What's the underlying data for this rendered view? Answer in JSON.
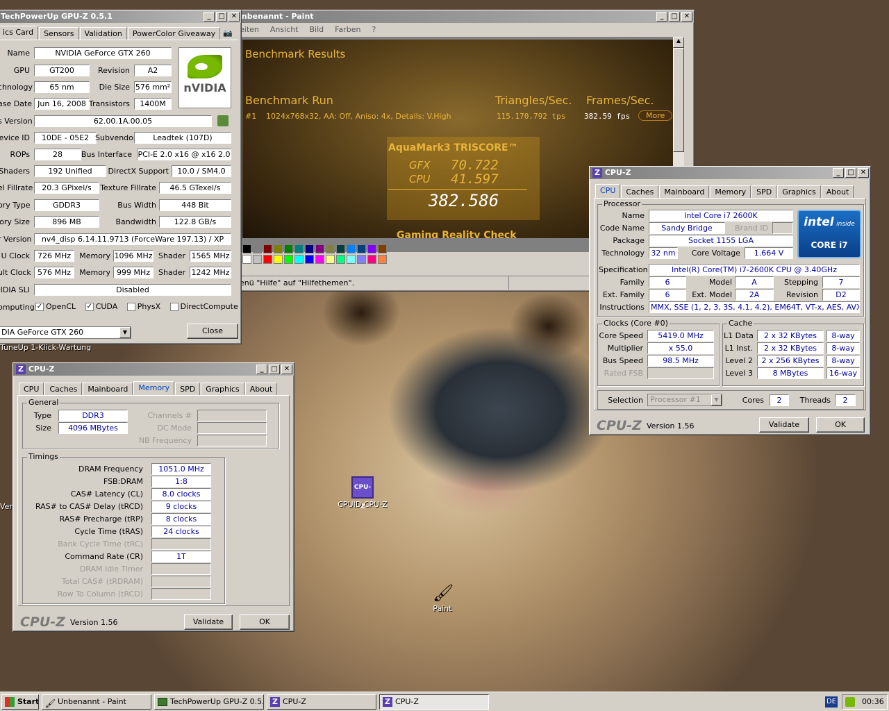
{
  "desktop": {
    "tuneup_label": "TuneUp 1-Klick-Wartung",
    "left_edge_label": "Verk",
    "cpuz_icon_label": "CPUID CPU-Z",
    "paint_icon_label": "Paint"
  },
  "paint": {
    "title": "Unbenannt - Paint",
    "menu": [
      "eiten",
      "Ansicht",
      "Bild",
      "Farben",
      "?"
    ],
    "status": "enü \"Hilfe\" auf \"Hilfethemen\".",
    "palette": [
      "#000000",
      "#808080",
      "#800000",
      "#808000",
      "#008000",
      "#008080",
      "#000080",
      "#800080",
      "#808040",
      "#004040",
      "#0080ff",
      "#004080",
      "#8000ff",
      "#804000",
      "#ffffff",
      "#c0c0c0",
      "#ff0000",
      "#ffff00",
      "#00ff00",
      "#00ffff",
      "#0000ff",
      "#ff00ff",
      "#ffff80",
      "#00ff80",
      "#80ffff",
      "#8080ff",
      "#ff0080",
      "#ff8040"
    ]
  },
  "bench": {
    "header": "Benchmark Results",
    "run": "Benchmark Run",
    "tri": "Triangles/Sec.",
    "fps": "Frames/Sec.",
    "row_num": "#1",
    "row_desc": "1024x768x32, AA: Off, Aniso: 4x, Details: V.High",
    "row_tri": "115.170.792 tps",
    "row_fps": "382.59 fps",
    "more": "More",
    "triscore_title": "AquaMark3 TRISCORE™",
    "gfx_label": "GFX",
    "gfx_value": "70.722",
    "cpu_label": "CPU",
    "cpu_value": "41.597",
    "total": "382.586",
    "gaming": "Gaming Reality Check"
  },
  "gpuz": {
    "title": "TechPowerUp GPU-Z 0.5.1",
    "tabs": [
      "ics Card",
      "Sensors",
      "Validation",
      "PowerColor Giveaway"
    ],
    "name_label": "Name",
    "name": "NVIDIA GeForce GTX 260",
    "gpu_label": "GPU",
    "gpu": "GT200",
    "revision_label": "Revision",
    "revision": "A2",
    "tech_label": "chnology",
    "tech": "65 nm",
    "die_label": "Die Size",
    "die": "576 mm²",
    "release_label": "ase Date",
    "release": "Jun 16, 2008",
    "transistors_label": "Transistors",
    "transistors": "1400M",
    "bios_label": "s Version",
    "bios": "62.00.1A.00.05",
    "devid_label": "evice ID",
    "devid": "10DE - 05E2",
    "subvendor_label": "Subvendor",
    "subvendor": "Leadtek (107D)",
    "rops_label": "ROPs",
    "rops": "28",
    "bus_label": "Bus Interface",
    "bus": "PCI-E 2.0 x16 @ x16 2.0",
    "shaders_label": "Shaders",
    "shaders": "192 Unified",
    "dx_label": "DirectX Support",
    "dx": "10.0 / SM4.0",
    "pfill_label": "el Fillrate",
    "pfill": "20.3 GPixel/s",
    "tfill_label": "Texture Fillrate",
    "tfill": "46.5 GTexel/s",
    "mtype_label": "ory Type",
    "mtype": "GDDR3",
    "bw_label": "Bus Width",
    "bw": "448 Bit",
    "msize_label": "ory Size",
    "msize": "896 MB",
    "bandwidth_label": "Bandwidth",
    "bandwidth": "122.8 GB/s",
    "driver_label": "r Version",
    "driver": "nv4_disp 6.14.11.9713 (ForceWare 197.13) / XP",
    "gclock_label": "U Clock",
    "gclock": "726 MHz",
    "mem_label": "Memory",
    "gmem": "1096 MHz",
    "shader_label": "Shader",
    "gshader": "1565 MHz",
    "dclock_label": "ult Clock",
    "dclock": "576 MHz",
    "dmem": "999 MHz",
    "dshader": "1242 MHz",
    "sli_label": "IDIA SLI",
    "sli": "Disabled",
    "computing_label": "omputing",
    "opencl": "OpenCL",
    "cuda": "CUDA",
    "physx": "PhysX",
    "directcompute": "DirectCompute",
    "select": "DIA GeForce GTX 260",
    "close": "Close",
    "logo": "nVIDIA"
  },
  "cpuz_cpu": {
    "title": "CPU-Z",
    "tabs": [
      "CPU",
      "Caches",
      "Mainboard",
      "Memory",
      "SPD",
      "Graphics",
      "About"
    ],
    "processor_group": "Processor",
    "name_label": "Name",
    "name": "Intel Core i7 2600K",
    "codename_label": "Code Name",
    "codename": "Sandy Bridge",
    "brandid_label": "Brand ID",
    "package_label": "Package",
    "package": "Socket 1155 LGA",
    "tech_label": "Technology",
    "tech": "32 nm",
    "voltage_label": "Core Voltage",
    "voltage": "1.664 V",
    "spec_label": "Specification",
    "spec": "Intel(R) Core(TM) i7-2600K CPU @ 3.40GHz",
    "family_label": "Family",
    "family": "6",
    "model_label": "Model",
    "model": "A",
    "stepping_label": "Stepping",
    "stepping": "7",
    "extfamily_label": "Ext. Family",
    "extfamily": "6",
    "extmodel_label": "Ext. Model",
    "extmodel": "2A",
    "revision_label": "Revision",
    "revision": "D2",
    "instr_label": "Instructions",
    "instr": "MMX, SSE (1, 2, 3, 3S, 4.1, 4.2), EM64T, VT-x, AES, AVX",
    "clocks_group": "Clocks (Core #0)",
    "corespeed_label": "Core Speed",
    "corespeed": "5419.0 MHz",
    "mult_label": "Multiplier",
    "mult": "x 55.0",
    "bus_label": "Bus Speed",
    "bus": "98.5 MHz",
    "fsb_label": "Rated FSB",
    "cache_group": "Cache",
    "l1d_label": "L1 Data",
    "l1d": "2 x 32 KBytes",
    "l1d_way": "8-way",
    "l1i_label": "L1 Inst.",
    "l1i": "2 x 32 KBytes",
    "l1i_way": "8-way",
    "l2_label": "Level 2",
    "l2": "2 x 256 KBytes",
    "l2_way": "8-way",
    "l3_label": "Level 3",
    "l3": "8 MBytes",
    "l3_way": "16-way",
    "selection_label": "Selection",
    "selection": "Processor #1",
    "cores_label": "Cores",
    "cores": "2",
    "threads_label": "Threads",
    "threads": "2",
    "logo": "CPU-Z",
    "version": "Version 1.56",
    "validate": "Validate",
    "ok": "OK",
    "intel_inside": "intel",
    "inside": "inside",
    "core": "CORE i7"
  },
  "cpuz_mem": {
    "title": "CPU-Z",
    "tabs": [
      "CPU",
      "Caches",
      "Mainboard",
      "Memory",
      "SPD",
      "Graphics",
      "About"
    ],
    "general_group": "General",
    "type_label": "Type",
    "type": "DDR3",
    "size_label": "Size",
    "size": "4096 MBytes",
    "channels_label": "Channels #",
    "dcmode_label": "DC Mode",
    "nbfreq_label": "NB Frequency",
    "timings_group": "Timings",
    "dram_label": "DRAM Frequency",
    "dram": "1051.0 MHz",
    "fsbdram_label": "FSB:DRAM",
    "fsbdram": "1:8",
    "cl_label": "CAS# Latency (CL)",
    "cl": "8.0 clocks",
    "trcd_label": "RAS# to CAS# Delay (tRCD)",
    "trcd": "9 clocks",
    "trp_label": "RAS# Precharge (tRP)",
    "trp": "8 clocks",
    "tras_label": "Cycle Time (tRAS)",
    "tras": "24 clocks",
    "trc_label": "Bank Cycle Time (tRC)",
    "cr_label": "Command Rate (CR)",
    "cr": "1T",
    "idle_label": "DRAM Idle Timer",
    "trdram_label": "Total CAS# (tRDRAM)",
    "trcd2_label": "Row To Column (tRCD)",
    "logo": "CPU-Z",
    "version": "Version 1.56",
    "validate": "Validate",
    "ok": "OK"
  },
  "taskbar": {
    "start": "Start",
    "items": [
      "Unbenannt - Paint",
      "TechPowerUp GPU-Z 0.5.1",
      "CPU-Z",
      "CPU-Z"
    ],
    "lang": "DE",
    "time": "00:36"
  }
}
